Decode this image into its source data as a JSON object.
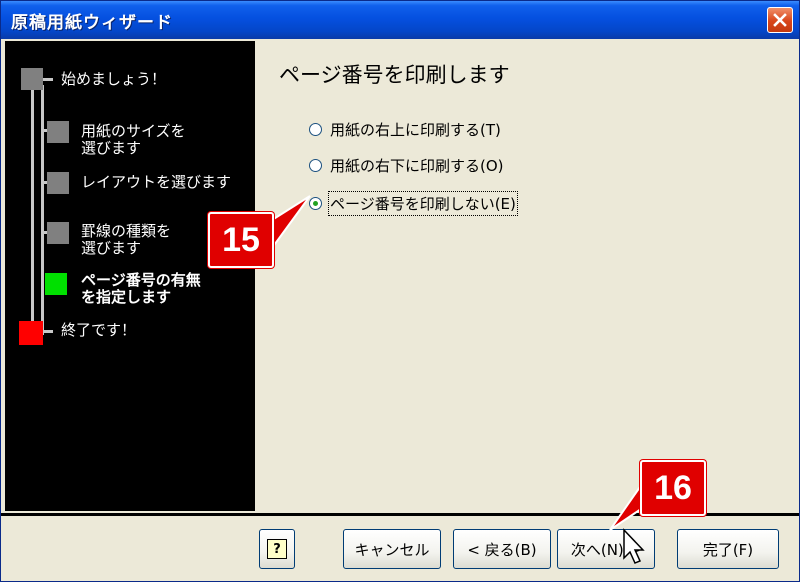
{
  "window": {
    "title": "原稿用紙ウィザード"
  },
  "steps": [
    {
      "label": "始めましょう！",
      "state": "done"
    },
    {
      "label": "用紙のサイズを\n選びます",
      "state": "done"
    },
    {
      "label": "レイアウトを選びます",
      "state": "done"
    },
    {
      "label": "罫線の種類を\n選びます",
      "state": "done"
    },
    {
      "label": "ページ番号の有無\nを指定します",
      "state": "current"
    },
    {
      "label": "終了です！",
      "state": "end"
    }
  ],
  "step_colors": {
    "done": "#808080",
    "current": "#00e000",
    "end": "#ff0000"
  },
  "page": {
    "heading": "ページ番号を印刷します",
    "options": [
      {
        "label": "用紙の右上に印刷する(T)",
        "checked": false
      },
      {
        "label": "用紙の右下に印刷する(O)",
        "checked": false
      },
      {
        "label": "ページ番号を印刷しない(E)",
        "checked": true
      }
    ]
  },
  "buttons": {
    "help": "?",
    "cancel": "キャンセル",
    "back": "< 戻る(B)",
    "next": "次へ(N) >",
    "finish": "完了(F)"
  },
  "callouts": {
    "first": "15",
    "second": "16"
  },
  "accent": {
    "callout": "#e00000",
    "title_bar": "#0550e0"
  }
}
